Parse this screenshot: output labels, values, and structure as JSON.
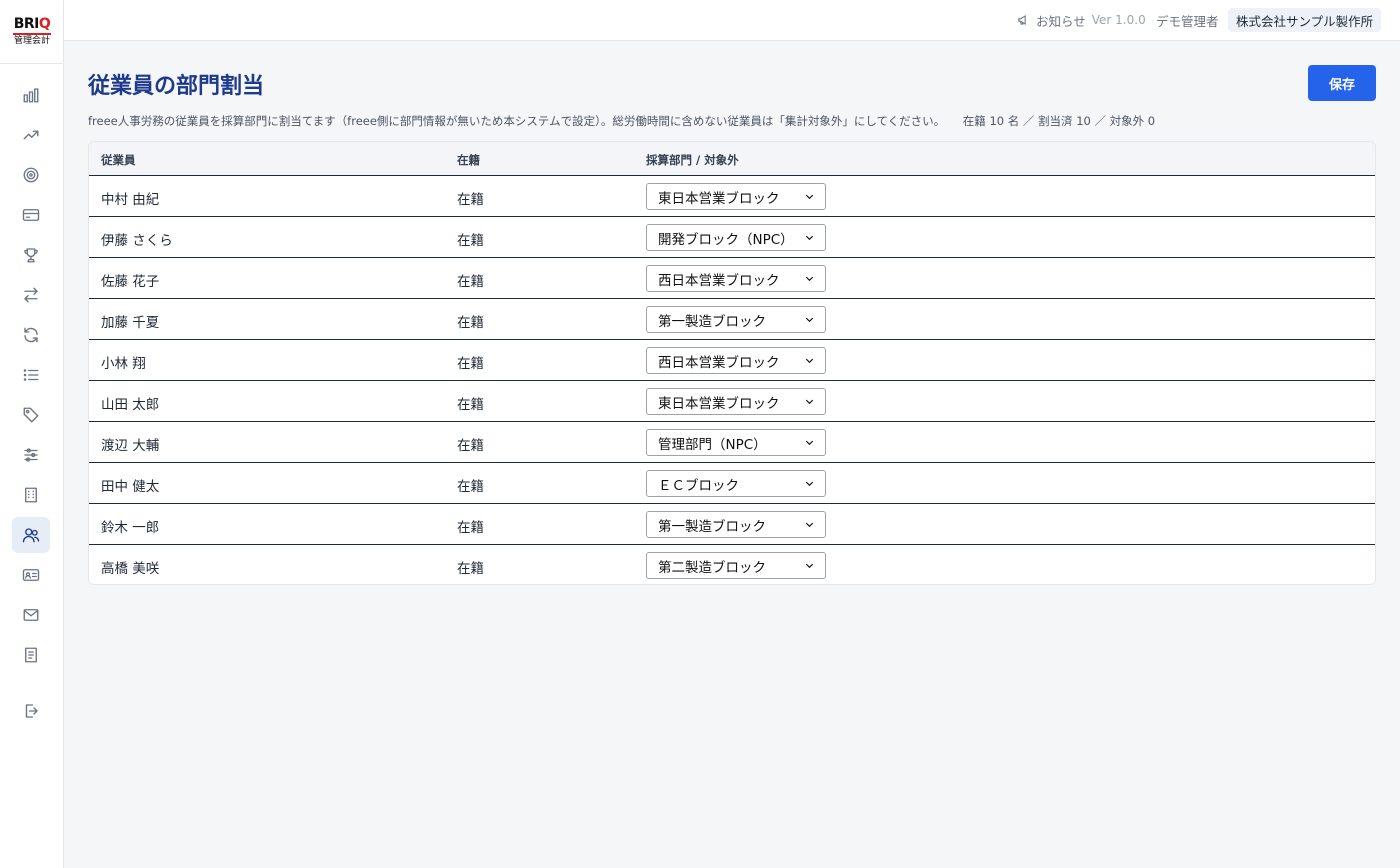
{
  "brand": {
    "logo_text": "BRIQ",
    "logo_sub": "管理会計",
    "accent": "#d61f26"
  },
  "sidebar": {
    "items": [
      {
        "name": "chart-bar-icon",
        "active": false
      },
      {
        "name": "trending-up-icon",
        "active": false
      },
      {
        "name": "target-icon",
        "active": false
      },
      {
        "name": "credit-card-icon",
        "active": false
      },
      {
        "name": "trophy-icon",
        "active": false
      },
      {
        "name": "transfer-icon",
        "active": false
      },
      {
        "name": "refresh-icon",
        "active": false
      },
      {
        "name": "list-icon",
        "active": false
      },
      {
        "name": "tag-icon",
        "active": false
      },
      {
        "name": "sliders-icon",
        "active": false
      },
      {
        "name": "building-icon",
        "active": false
      },
      {
        "name": "users-icon",
        "active": true
      },
      {
        "name": "id-card-icon",
        "active": false
      },
      {
        "name": "mail-icon",
        "active": false
      },
      {
        "name": "receipt-icon",
        "active": false
      },
      {
        "name": "logout-icon",
        "active": false
      }
    ]
  },
  "header": {
    "notice_label": "お知らせ",
    "version": "Ver 1.0.0",
    "user": "デモ管理者",
    "company": "株式会社サンプル製作所"
  },
  "page": {
    "title": "従業員の部門割当",
    "save_label": "保存",
    "description": "freee人事労務の従業員を採算部門に割当てます（freee側に部門情報が無いため本システムで設定）。総労働時間に含めない従業員は「集計対象外」にしてください。",
    "counts": "在籍 10 名 ／ 割当済 10 ／ 対象外 0"
  },
  "table": {
    "headers": {
      "employee": "従業員",
      "status": "在籍",
      "department": "採算部門 / 対象外"
    },
    "rows": [
      {
        "name": "中村 由紀",
        "status": "在籍",
        "department": "東日本営業ブロック"
      },
      {
        "name": "伊藤 さくら",
        "status": "在籍",
        "department": "開発ブロック（NPC）"
      },
      {
        "name": "佐藤 花子",
        "status": "在籍",
        "department": "西日本営業ブロック"
      },
      {
        "name": "加藤 千夏",
        "status": "在籍",
        "department": "第一製造ブロック"
      },
      {
        "name": "小林 翔",
        "status": "在籍",
        "department": "西日本営業ブロック"
      },
      {
        "name": "山田 太郎",
        "status": "在籍",
        "department": "東日本営業ブロック"
      },
      {
        "name": "渡辺 大輔",
        "status": "在籍",
        "department": "管理部門（NPC）"
      },
      {
        "name": "田中 健太",
        "status": "在籍",
        "department": "ＥＣブロック"
      },
      {
        "name": "鈴木 一郎",
        "status": "在籍",
        "department": "第一製造ブロック"
      },
      {
        "name": "高橋 美咲",
        "status": "在籍",
        "department": "第二製造ブロック"
      }
    ]
  },
  "colors": {
    "primary": "#2563eb",
    "title": "#1e3a8a"
  }
}
